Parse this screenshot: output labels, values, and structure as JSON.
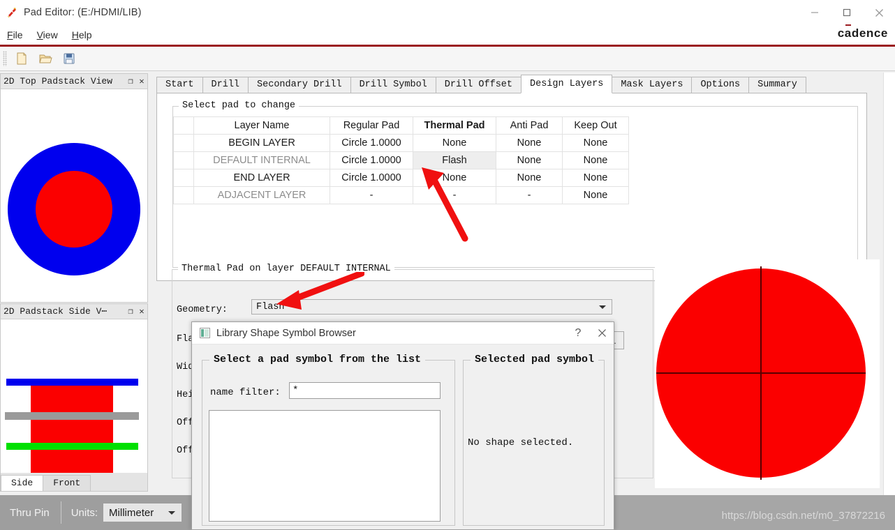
{
  "window": {
    "title": "Pad Editor:  (E:/HDMI/LIB)",
    "brand_pre": "c",
    "brand_bar": "ā",
    "brand_post": "dence",
    "minimize_label": "Minimize",
    "maximize_label": "Maximize",
    "close_label": "Close"
  },
  "menubar": {
    "items": [
      {
        "name": "file",
        "pre": "",
        "accel": "F",
        "post": "ile"
      },
      {
        "name": "view",
        "pre": "",
        "accel": "V",
        "post": "iew"
      },
      {
        "name": "help",
        "pre": "",
        "accel": "H",
        "post": "elp"
      }
    ]
  },
  "toolbar": {
    "buttons": [
      {
        "name": "new-file-button",
        "icon": "new-file-icon"
      },
      {
        "name": "open-folder-button",
        "icon": "open-folder-icon"
      },
      {
        "name": "save-button",
        "icon": "save-disk-icon"
      }
    ]
  },
  "left_dock": {
    "top_panel": {
      "title": "2D Top Padstack View",
      "float_label": "❐",
      "close_label": "✕"
    },
    "side_panel": {
      "title": "2D Padstack Side V⋯",
      "float_label": "❐",
      "close_label": "✕",
      "tabs": [
        {
          "label": "Side",
          "active": true
        },
        {
          "label": "Front",
          "active": false
        }
      ]
    }
  },
  "main": {
    "tabs": [
      {
        "label": "Start",
        "active": false
      },
      {
        "label": "Drill",
        "active": false
      },
      {
        "label": "Secondary Drill",
        "active": false
      },
      {
        "label": "Drill Symbol",
        "active": false
      },
      {
        "label": "Drill Offset",
        "active": false
      },
      {
        "label": "Design Layers",
        "active": true
      },
      {
        "label": "Mask Layers",
        "active": false
      },
      {
        "label": "Options",
        "active": false
      },
      {
        "label": "Summary",
        "active": false
      }
    ],
    "select_pad_group": "Select pad to change",
    "table": {
      "headers": [
        "Layer Name",
        "Regular Pad",
        "Thermal Pad",
        "Anti Pad",
        "Keep Out"
      ],
      "bold_header_index": 2,
      "rows": [
        {
          "layer": "BEGIN LAYER",
          "dim": false,
          "cells": [
            "Circle 1.0000",
            "None",
            "None",
            "None"
          ],
          "selected_index": -1
        },
        {
          "layer": "DEFAULT INTERNAL",
          "dim": true,
          "cells": [
            "Circle 1.0000",
            "Flash",
            "None",
            "None"
          ],
          "selected_index": 1
        },
        {
          "layer": "END LAYER",
          "dim": false,
          "cells": [
            "Circle 1.0000",
            "None",
            "None",
            "None"
          ],
          "selected_index": -1
        },
        {
          "layer": "ADJACENT LAYER",
          "dim": true,
          "cells": [
            "-",
            "-",
            "-",
            "None"
          ],
          "selected_index": -1
        }
      ]
    },
    "thermal_group": "Thermal Pad on layer DEFAULT INTERNAL",
    "fields": [
      {
        "name": "geometry",
        "label": "Geometry:",
        "value": "Flash",
        "type": "combo"
      },
      {
        "name": "flash-name",
        "label": "Fla",
        "value": "",
        "type": "text"
      },
      {
        "name": "width",
        "label": "Wid",
        "value": "",
        "type": "text"
      },
      {
        "name": "height",
        "label": "Hei",
        "value": "",
        "type": "text"
      },
      {
        "name": "offset-x",
        "label": "Off",
        "value": "",
        "type": "text"
      },
      {
        "name": "offset-y",
        "label": "Off",
        "value": "",
        "type": "text"
      }
    ],
    "browse_button_label": "..."
  },
  "dialog": {
    "title": "Library Shape Symbol Browser",
    "help_label": "?",
    "close_label": "✕",
    "left_group": "Select a pad symbol from the list",
    "right_group": "Selected pad symbol",
    "filter_label": "name filter:",
    "filter_value": "*",
    "list_items": [],
    "no_selection_text": "No shape selected."
  },
  "statusbar": {
    "mode": "Thru Pin",
    "units_label": "Units:",
    "units_value": "Millimeter",
    "watermark": "https://blog.csdn.net/m0_37872216"
  },
  "colors": {
    "brand_red": "#9b1b20",
    "pad_red": "#fb0000",
    "pad_blue": "#0000ee",
    "pad_green": "#00e000",
    "pad_gray": "#9a9a9a",
    "annotation_arrow": "#f01010",
    "selected_row": "#eeeeee"
  },
  "graphics": {
    "top_view": {
      "outer": "blue-ring",
      "inner": "red-circle"
    },
    "side_view": {
      "top_layer": "blue-bar",
      "mid_layer": "gray-bar",
      "bottom_layer": "green-bar",
      "barrel": "red-rect"
    },
    "preview": {
      "shape": "red-circle-with-crosshair"
    }
  },
  "annotations": [
    {
      "name": "arrow-to-flash-cell",
      "target": "thermal-pad-flash-cell"
    },
    {
      "name": "arrow-to-geometry-combo",
      "target": "geometry-combo"
    }
  ]
}
